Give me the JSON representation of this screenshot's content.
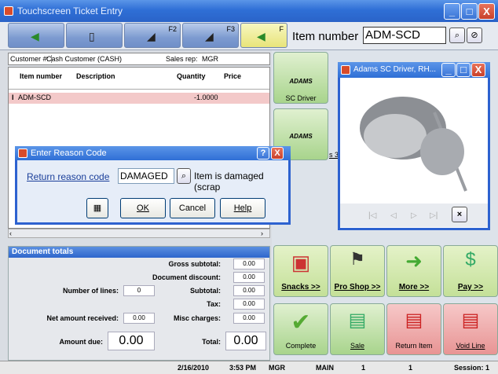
{
  "window": {
    "title": "Touchscreen Ticket Entry",
    "buttons": [
      "_",
      "□",
      "X"
    ]
  },
  "toolbar": {
    "buttons": [
      {
        "fkey": "",
        "icon": "arrow-left-icon"
      },
      {
        "fkey": "",
        "icon": "document-icon"
      },
      {
        "fkey": "F2",
        "icon": "shoe-icon"
      },
      {
        "fkey": "F3",
        "icon": "shoe-icon"
      },
      {
        "fkey": "F",
        "icon": "arrow-icon"
      }
    ],
    "item_number_label": "Item number",
    "item_number_value": "ADM-SCD",
    "search_btn": "⌕",
    "clear_btn": "⊘"
  },
  "customer": {
    "label": "Customer #:",
    "value": "Cash Customer  (CASH)",
    "salesrep_label": "Sales rep:",
    "salesrep_value": "MGR"
  },
  "grid": {
    "columns": [
      "Item number",
      "Description",
      "Quantity",
      "Price"
    ],
    "rows": [
      {
        "item": "ADM-SCD",
        "description": "",
        "quantity": "-1.0000",
        "price": ""
      }
    ]
  },
  "totals": {
    "title": "Document totals",
    "gross_subtotal_label": "Gross subtotal:",
    "gross_subtotal": "0.00",
    "doc_discount_label": "Document discount:",
    "doc_discount": "0.00",
    "lines_label": "Number of lines:",
    "lines": "0",
    "subtotal_label": "Subtotal:",
    "subtotal": "0.00",
    "tax_label": "Tax:",
    "tax": "0.00",
    "net_received_label": "Net amount received:",
    "net_received": "0.00",
    "misc_label": "Misc charges:",
    "misc": "0.00",
    "amount_due_label": "Amount due:",
    "amount_due": "0.00",
    "total_label": "Total:",
    "total": "0.00"
  },
  "panel": {
    "adams1": "ADAMS",
    "sc_driver": "SC Driver",
    "adams2": "ADAMS",
    "s3": "s 3",
    "snacks": "Snacks >>",
    "proshop": "Pro Shop >>",
    "more": "More >>",
    "pay": "Pay >>",
    "complete": "Complete",
    "sale": "Sale",
    "return_item": "Return Item",
    "void_line": "Void Line"
  },
  "dialog": {
    "title": "Enter Reason Code",
    "help_btn": "?",
    "close_btn": "X",
    "label": "Return reason code",
    "value": "DAMAGED",
    "description": "Item is damaged (scrap",
    "ok": "OK",
    "cancel": "Cancel",
    "help": "Help"
  },
  "image_window": {
    "title": "Adams SC Driver, RH...",
    "close": "×"
  },
  "status": {
    "date": "2/16/2010",
    "time": "3:53 PM",
    "user": "MGR",
    "store": "MAIN",
    "f1": "1",
    "f2": "1",
    "session": "Session: 1"
  }
}
